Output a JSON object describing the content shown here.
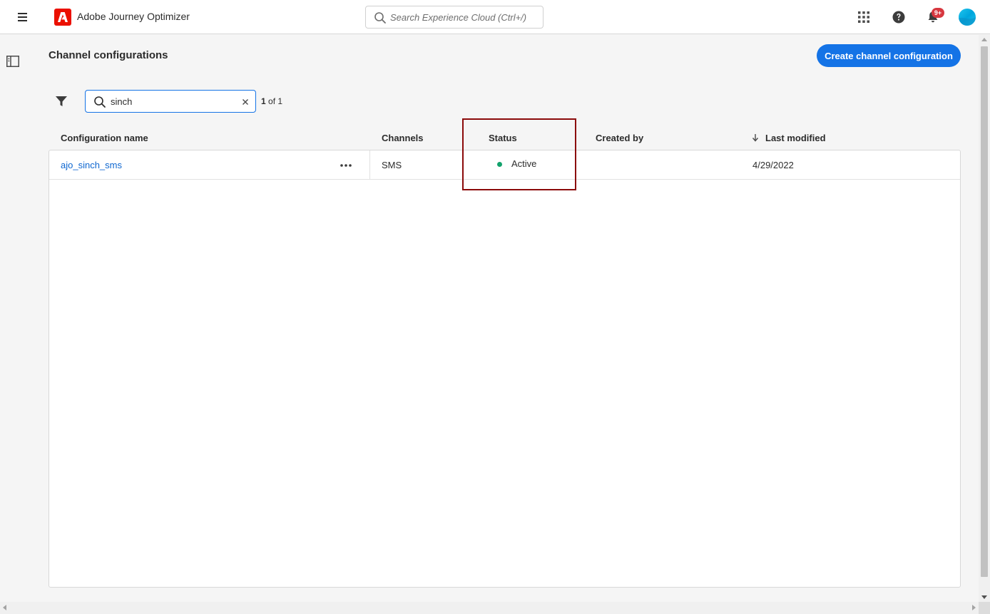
{
  "app": {
    "title": "Adobe Journey Optimizer",
    "brand_color": "#eb1000",
    "accent_color": "#1473e6"
  },
  "topbar": {
    "search_placeholder": "Search Experience Cloud (Ctrl+/)",
    "notification_badge": "9+",
    "icons": [
      "menu-icon",
      "adobe-logo-icon",
      "search-icon",
      "apps-grid-icon",
      "help-icon",
      "bell-icon",
      "avatar"
    ]
  },
  "page": {
    "title": "Channel configurations",
    "create_button_label": "Create channel configuration"
  },
  "filter": {
    "search_value": "sinch",
    "result_current": "1",
    "result_suffix": " of 1"
  },
  "table": {
    "columns": {
      "name": "Configuration name",
      "channels": "Channels",
      "status": "Status",
      "created_by": "Created by",
      "last_modified": "Last modified"
    },
    "sorted_by": "last_modified",
    "sort_direction": "descending",
    "rows": [
      {
        "name": "ajo_sinch_sms",
        "channels": "SMS",
        "status": "Active",
        "status_color": "#12a26c",
        "created_by": "",
        "last_modified": "4/29/2022"
      }
    ]
  },
  "annotation": {
    "highlight_color": "#8b0a0a"
  }
}
